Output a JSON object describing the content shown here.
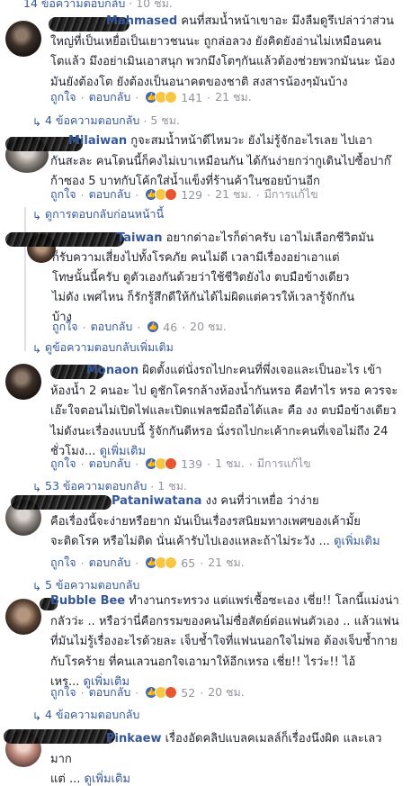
{
  "top_reply": {
    "label": "14 ข้อความตอบกลับ",
    "time": "10 ชม."
  },
  "common": {
    "like": "ถูกใจ",
    "reply": "ตอบกลับ",
    "edited": "มีการแก้ไข",
    "see_more": "ดูเพิ่มเติม"
  },
  "comments": [
    {
      "name": "Mahmased",
      "line1": "คนที่สมน้ำหน้าเขาอะ มึงลืมดูรึเปล่าว่าส่วน",
      "line2": "ใหญ่ที่เป็นเหยื่อเป็นเยาวชนนะ ถูกล่อลวง ยังคิดยังอ่านไม่เหมือนคน",
      "line3": "โตแล้ว มึงอย่าเมินเอาสนุก พวกมึงโตๆกันแล้วต้องช่วยพวกมันนะ น้อง",
      "line4": "มันยังต้องโต ยังต้องเป็นอนาคตของชาติ สงสารน้องๆมันบ้าง",
      "reactions": "141",
      "time": "21 ชม.",
      "replies": "4 ข้อความตอบกลับ",
      "replies_time": "5 ชม."
    },
    {
      "name": "Milaiwan",
      "line1": "กูจะสมน้ำหน้าดีไหมวะ ยังไม่รู้จักอะไรเลย ไปเอา",
      "line2": "กันสะละ คนโดนนี้ก็คงไม่เบาเหมือนกัน ได้กันง่ายกว่ากูเดินไปซื้อปาก๊",
      "line3": "ก้าซอง 5 บาทกับโค้กใส่น้ำแข็งที่ร้านค้าในซอยบ้านอีก",
      "reactions": "129",
      "time": "21 ชม."
    },
    {
      "prev_label": "ดูการตอบกลับก่อนหน้านี้"
    },
    {
      "name": "Taiwan",
      "line1": "อยากด่าอะไรก็ด่าครับ เอาไม่เลือกชีวิตมัน",
      "line2": "ก็รับความเสี่ยงไปทั้งโรคภัย คนไม่ดี เวลามีเรื่องอย่าเอาแต่",
      "line3": "โทษนั้นนี้ครับ ดูตัวเองกันด้วยว่าใช้ชีวิตยังไง ตบมือข้างเดียว",
      "line4": "ไม่ดัง เพศไหน ก็รักรู้สึกดีให้กันได้ไม่ผิดแต่ควรให้เวลารู้จักกัน",
      "line5": "บ้าง",
      "reactions": "46",
      "time": "20 ชม.",
      "more_label": "ดูข้อความตอบกลับเพิ่มเติม"
    },
    {
      "name": "Monaon",
      "line1": "ผิดตั้งแต่นั่งรถไปกะคนที่พึ่งเจอและเป็นอะไร เข้า",
      "line2": "ห้องน้ำ 2 คนอะ ไป ดูชักโครกล้างห้องน้ำกันหรอ คือทำไร หรอ ควรจะ",
      "line3": "เอ๊ะใจตอนไม่เปิดไฟและเปิดแฟลชมือถือได้และ คือ งง ตบมือข้างเดียว",
      "line4": "ไม่ดังนะเรื่องแบบนี้ รู้จักกันดีหรอ นั่งรถไปกะเค้ากะคนที่เจอไม่ถึง 24",
      "line5": "ชั่วโมง...",
      "reactions": "139",
      "time": "1 ชม.",
      "replies": "53 ข้อความตอบกลับ",
      "replies_time": "1 ชม."
    },
    {
      "name": "Pataniwatana",
      "line1": "งง คนที่ว่าเหยื่อ ว่าง่าย",
      "line2": "คือเรื่องนี้จะง่ายหรือยาก มันเป็นเรื่องรสนิยมทางเพศของเค้ามั้ย",
      "line3": "จะติดโรค หรือไม่ติด นั่นเค้ารับไปเองแหละถ้าไม่ระวัง ...",
      "reactions": "65",
      "time": "21 ชม.",
      "replies": "5 ข้อความตอบกลับ"
    },
    {
      "name": "Bubble Bee",
      "line1": "ทำงานกระทรวง แต่แพร่เชื้อซะเอง เชี่ย!! โลกนี้แม่งน่า",
      "line2": "กลัวว่ะ .. หรือว่านี่คือกรรมของคนไม่ซื่อสัตย์ต่อแฟนตัวเอง .. แล้วแฟน",
      "line3": "ที่มันไม่รู้เรื่องอะไรด้วยละ เจ็บช้ำใจที่แฟนนอกใจไม่พอ ต้องเจ็บช้ำกาย",
      "line4": "กับโรคร้าย ที่คนเลวนอกใจเอามาให้อีกเหรอ เชี่ย!! ไรว่ะ!! ไอ้",
      "line5": "เหร...",
      "reactions": "52",
      "time": "20 ชม.",
      "replies": "4 ข้อความตอบกลับ"
    },
    {
      "name": "Pinkaew",
      "line1": "เรื่องอัดคลิปแบลคเมลล์ก็เรื่องนึงผิด และเลว",
      "line2": "มาก",
      "line3": "แต่ ..."
    }
  ],
  "colors": {
    "link": "#365899",
    "meta": "#90949c",
    "text": "#1d2129",
    "like_blue": "#4267b2"
  },
  "icons": [
    "like-reaction-icon",
    "haha-reaction-icon",
    "wow-reaction-icon",
    "angry-reaction-icon",
    "sad-reaction-icon",
    "reply-arrow-icon"
  ]
}
